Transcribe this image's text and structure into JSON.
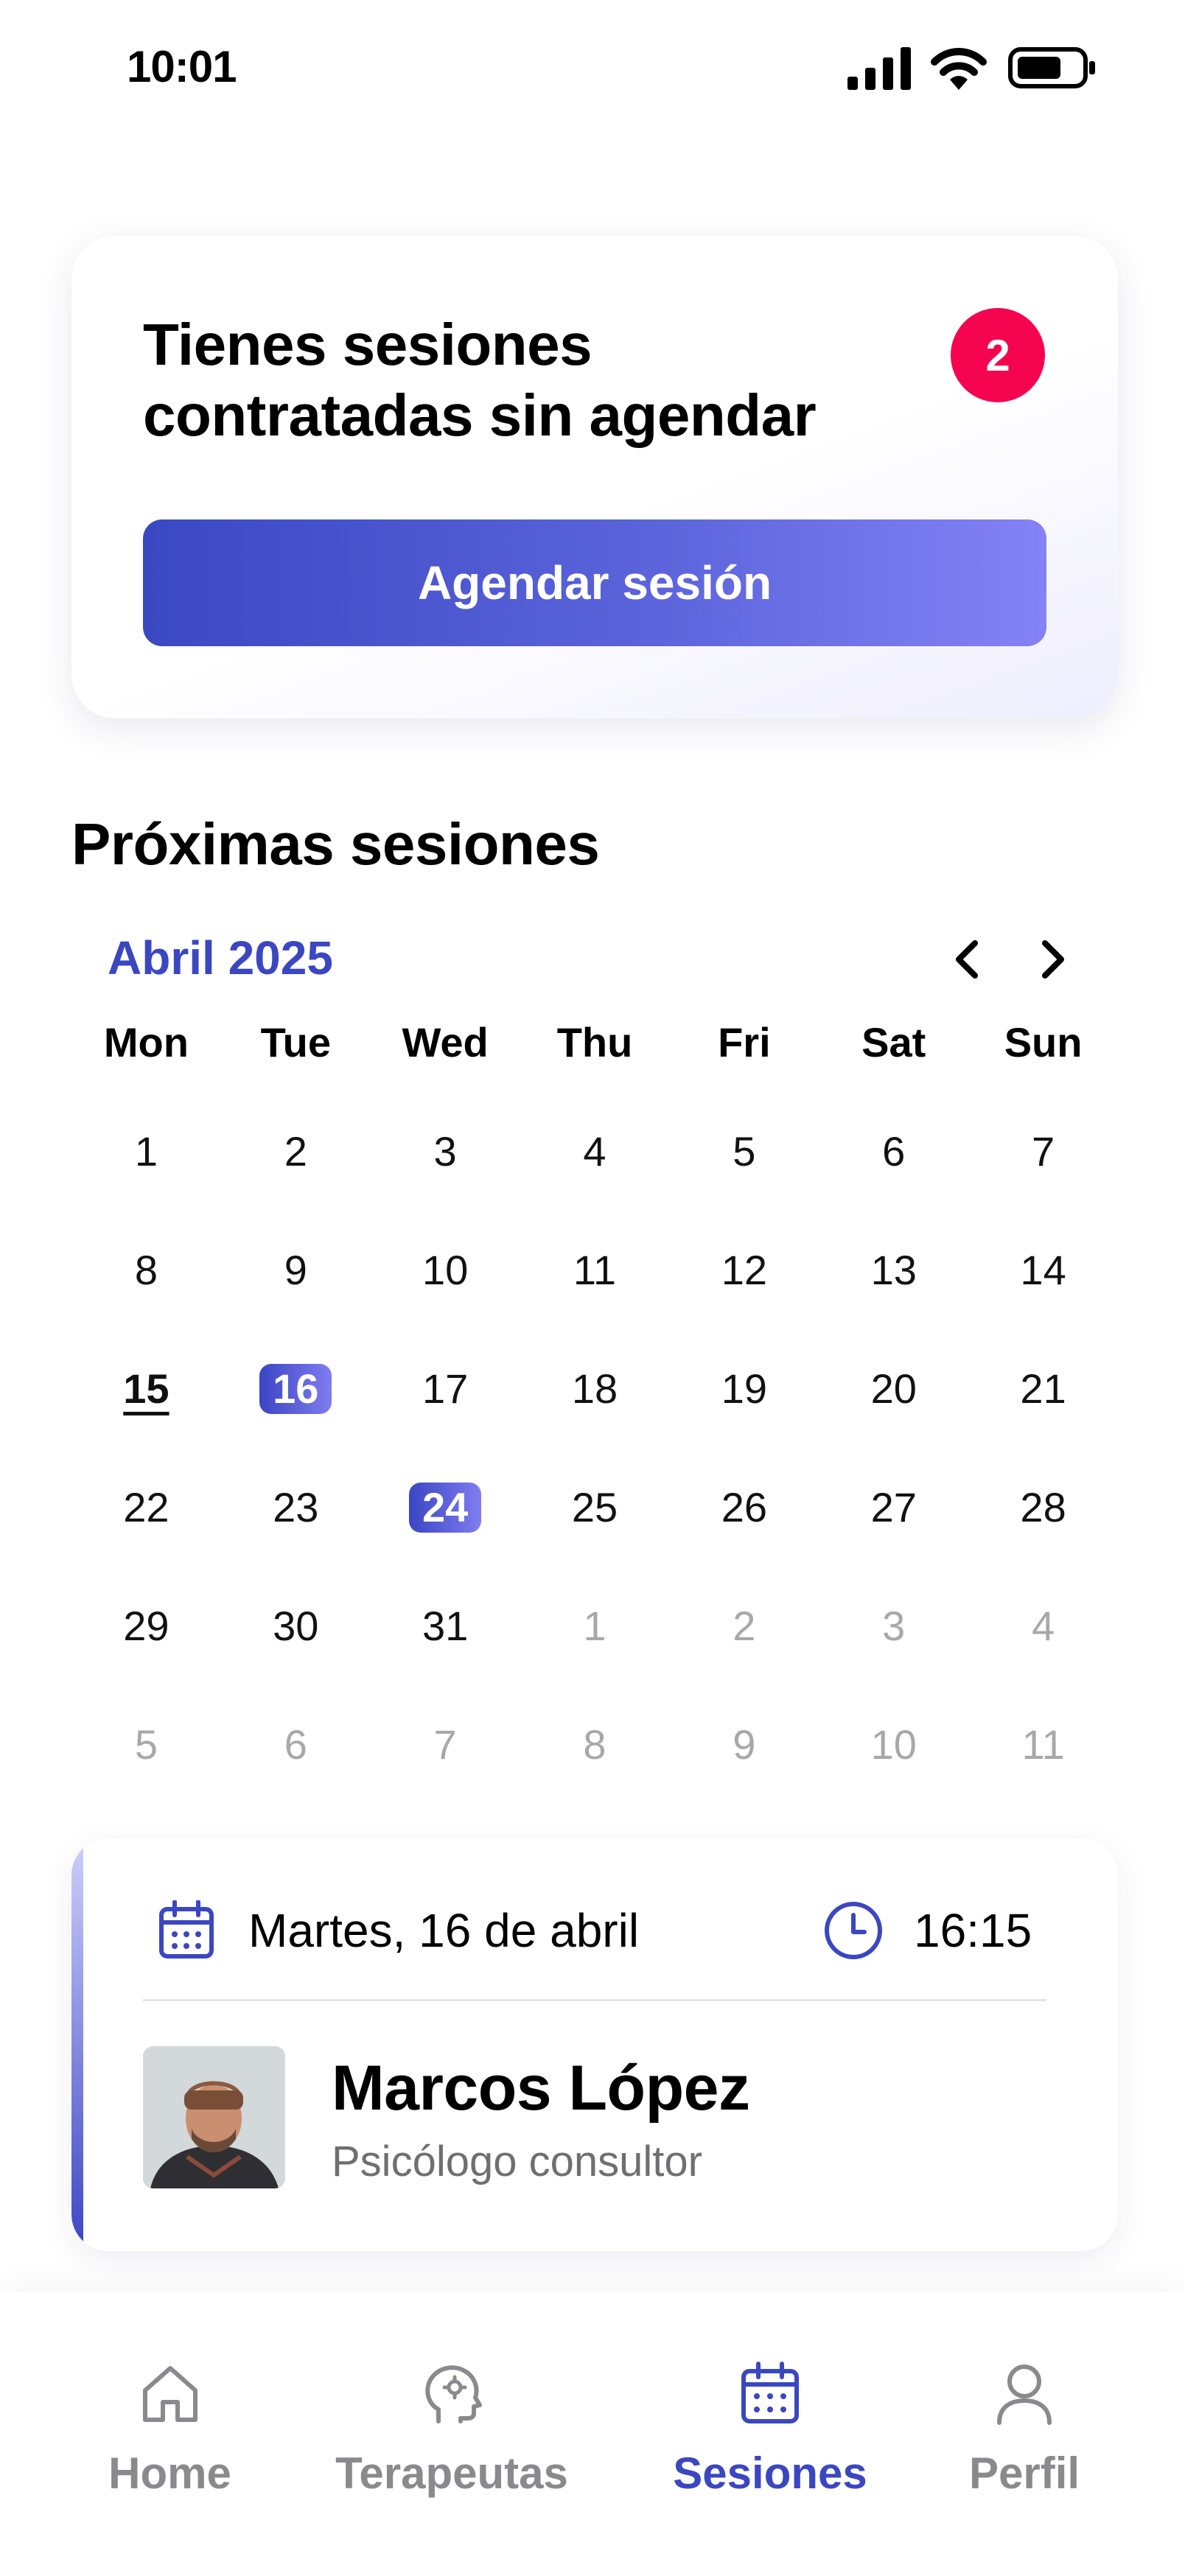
{
  "status_bar": {
    "time": "10:01"
  },
  "pending_card": {
    "title": "Tienes sesiones contratadas sin agendar",
    "badge_count": "2",
    "button_label": "Agendar sesión"
  },
  "upcoming": {
    "title": "Próximas sesiones",
    "month_label": "Abril 2025",
    "weekdays": [
      "Mon",
      "Tue",
      "Wed",
      "Thu",
      "Fri",
      "Sat",
      "Sun"
    ],
    "weeks": [
      [
        "1",
        "2",
        "3",
        "4",
        "5",
        "6",
        "7"
      ],
      [
        "8",
        "9",
        "10",
        "11",
        "12",
        "13",
        "14"
      ],
      [
        "15",
        "16",
        "17",
        "18",
        "19",
        "20",
        "21"
      ],
      [
        "22",
        "23",
        "24",
        "25",
        "26",
        "27",
        "28"
      ],
      [
        "29",
        "30",
        "31",
        "1",
        "2",
        "3",
        "4"
      ],
      [
        "5",
        "6",
        "7",
        "8",
        "9",
        "10",
        "11"
      ]
    ],
    "today": "15",
    "session_days": [
      "16",
      "24"
    ]
  },
  "session_card": {
    "date": "Martes, 16 de abril",
    "time": "16:15",
    "therapist_name": "Marcos López",
    "therapist_role": "Psicólogo consultor"
  },
  "bottom_nav": {
    "items": [
      {
        "label": "Home",
        "icon": "home-icon",
        "active": false
      },
      {
        "label": "Terapeutas",
        "icon": "brain-head-icon",
        "active": false
      },
      {
        "label": "Sesiones",
        "icon": "calendar-icon",
        "active": true
      },
      {
        "label": "Perfil",
        "icon": "user-icon",
        "active": false
      }
    ]
  },
  "colors": {
    "accent": "#3b47c1",
    "badge": "#f5054f",
    "muted_text": "#6e6e73",
    "inactive_nav": "#8a8a8e"
  }
}
